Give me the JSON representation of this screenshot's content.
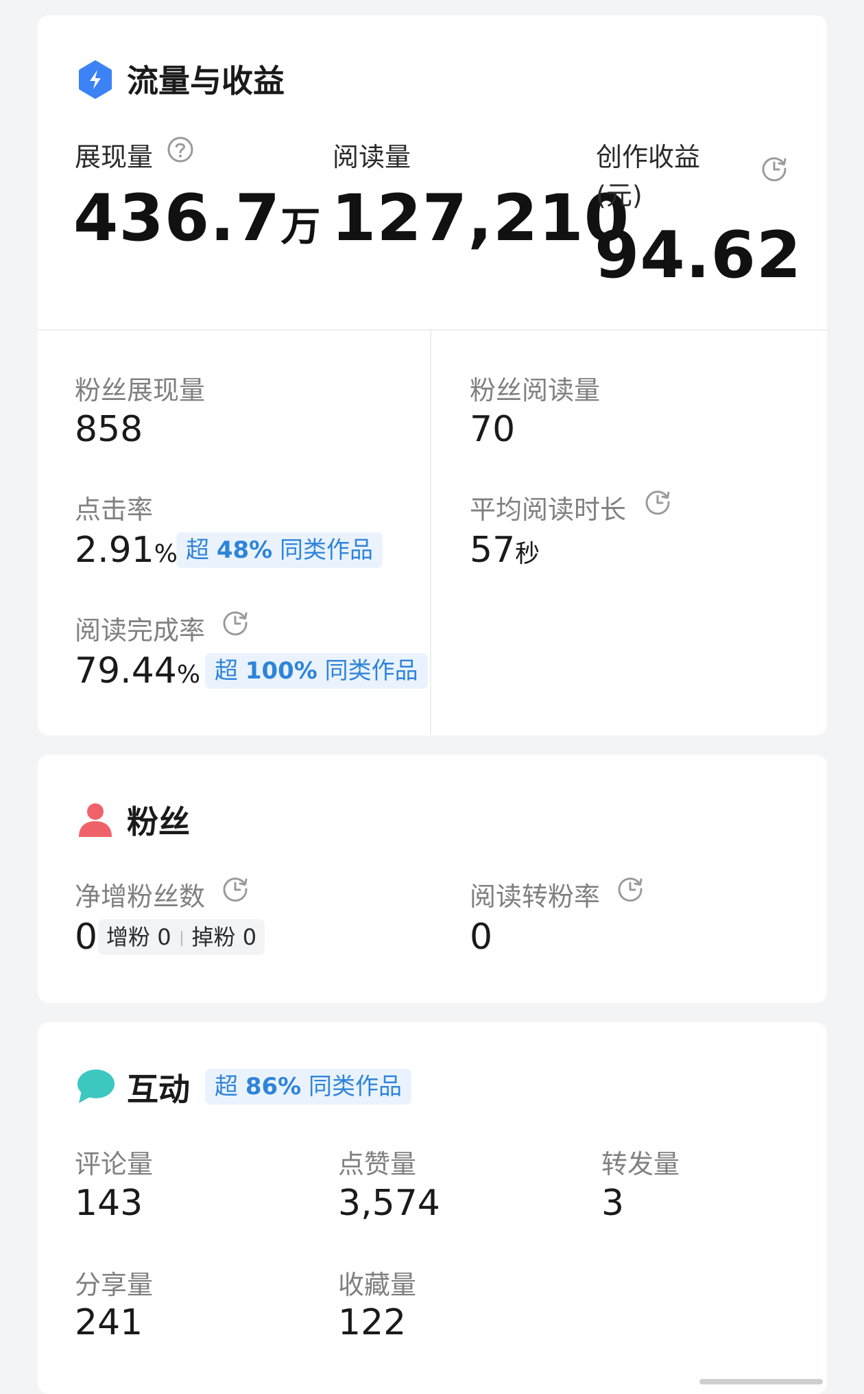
{
  "traffic": {
    "title": "流量与收益",
    "impressions": {
      "label": "展现量",
      "value": "436.7",
      "unit": "万"
    },
    "reads": {
      "label": "阅读量",
      "value": "127,210"
    },
    "earnings": {
      "label_line1": "创作收益",
      "label_line2": "(元)",
      "value": "94.62"
    },
    "fan_impressions": {
      "label": "粉丝展现量",
      "value": "858"
    },
    "fan_reads": {
      "label": "粉丝阅读量",
      "value": "70"
    },
    "ctr": {
      "label": "点击率",
      "value": "2.91",
      "unit": "%",
      "badge_prefix": "超",
      "badge_pct": "48%",
      "badge_suffix": "同类作品"
    },
    "avg_read_time": {
      "label": "平均阅读时长",
      "value": "57",
      "unit": "秒"
    },
    "completion": {
      "label": "阅读完成率",
      "value": "79.44",
      "unit": "%",
      "badge_prefix": "超",
      "badge_pct": "100%",
      "badge_suffix": "同类作品"
    }
  },
  "fans": {
    "title": "粉丝",
    "net_new": {
      "label": "净增粉丝数",
      "value": "0",
      "gain_label": "增粉",
      "gain_value": "0",
      "loss_label": "掉粉",
      "loss_value": "0"
    },
    "conversion": {
      "label": "阅读转粉率",
      "value": "0"
    }
  },
  "interaction": {
    "title": "互动",
    "badge_prefix": "超",
    "badge_pct": "86%",
    "badge_suffix": "同类作品",
    "comments": {
      "label": "评论量",
      "value": "143"
    },
    "likes": {
      "label": "点赞量",
      "value": "3,574"
    },
    "reposts": {
      "label": "转发量",
      "value": "3"
    },
    "shares": {
      "label": "分享量",
      "value": "241"
    },
    "favorites": {
      "label": "收藏量",
      "value": "122"
    }
  },
  "colors": {
    "accent_blue": "#2f84d9",
    "traffic_icon": "#3b82f6",
    "fans_icon": "#f0626a",
    "interaction_icon": "#3cc8bf"
  },
  "icons": {
    "traffic": "lightning-icon",
    "fans": "person-icon",
    "interaction": "chat-bubble-icon",
    "help": "question-circle-icon",
    "history": "clock-history-icon"
  }
}
